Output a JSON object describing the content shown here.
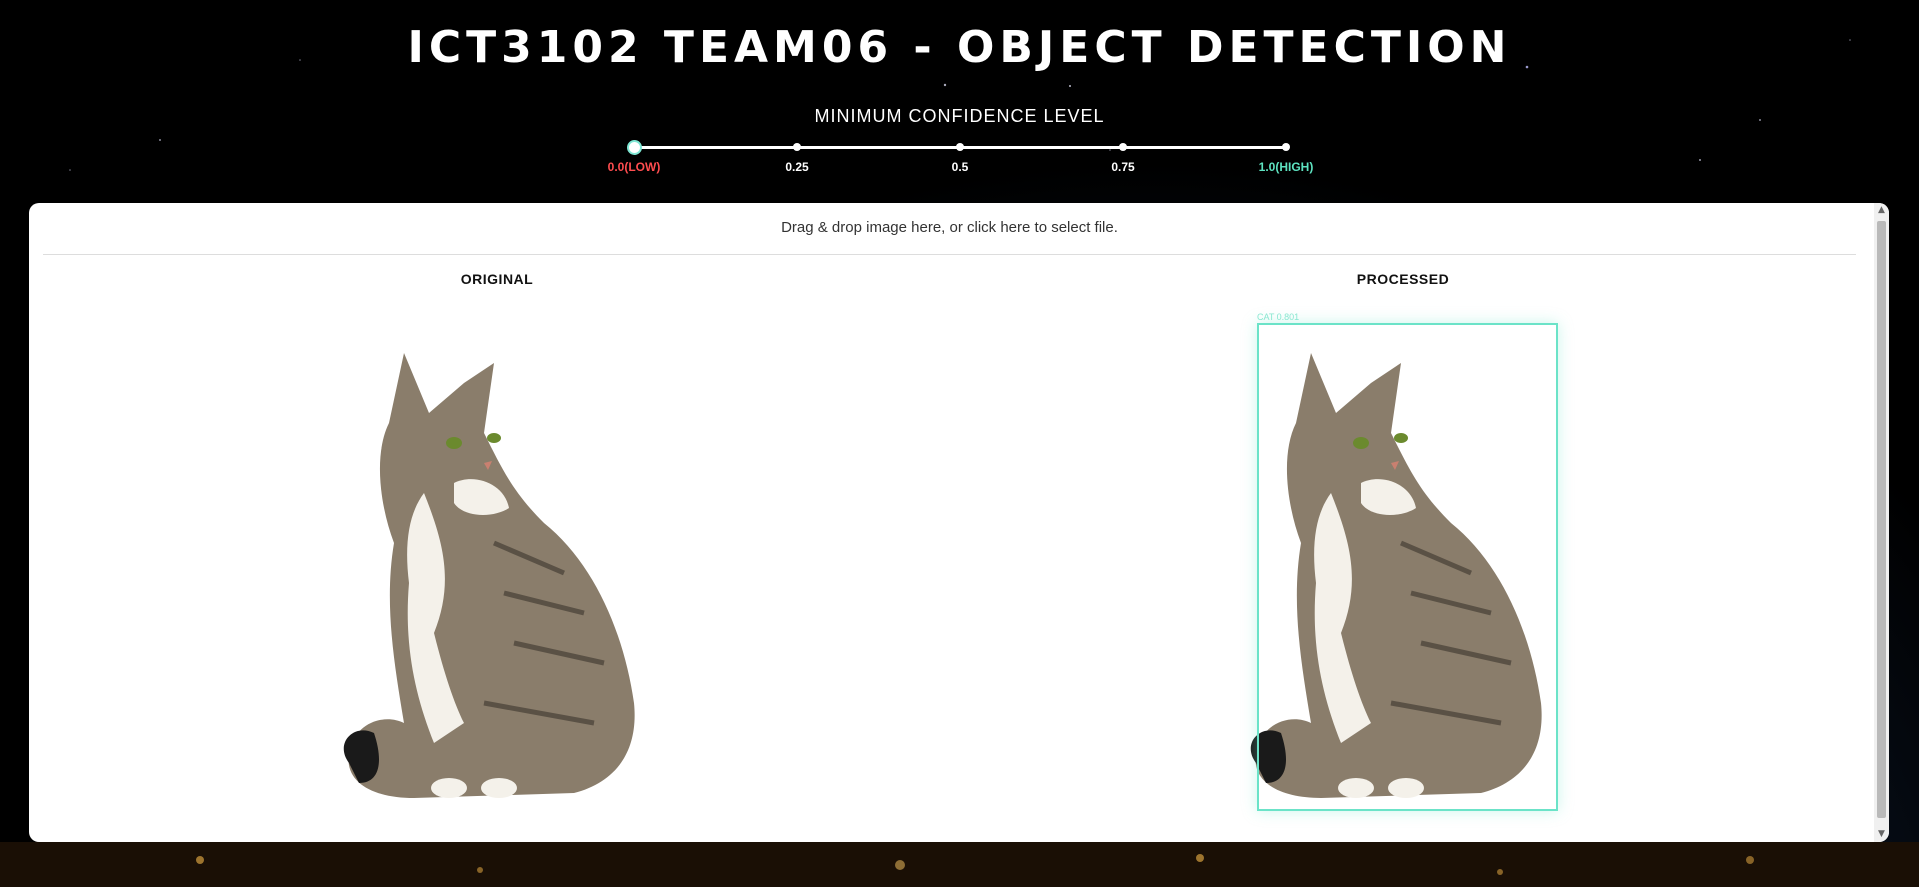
{
  "header": {
    "title": "ICT3102 TEAM06 - OBJECT DETECTION",
    "confidence_label": "MINIMUM CONFIDENCE LEVEL"
  },
  "slider": {
    "value": 0.0,
    "marks": [
      {
        "value": 0.0,
        "label": "0.0(LOW)",
        "color": "#ff4d4f"
      },
      {
        "value": 0.25,
        "label": "0.25",
        "color": "#ffffff"
      },
      {
        "value": 0.5,
        "label": "0.5",
        "color": "#ffffff"
      },
      {
        "value": 0.75,
        "label": "0.75",
        "color": "#ffffff"
      },
      {
        "value": 1.0,
        "label": "1.0(HIGH)",
        "color": "#5ee3c1"
      }
    ]
  },
  "dropzone": {
    "text": "Drag & drop image here, or click here to select file."
  },
  "columns": {
    "original": "ORIGINAL",
    "processed": "PROCESSED"
  },
  "detection": {
    "label": "CAT 0.801",
    "color": "#6be3c8"
  }
}
